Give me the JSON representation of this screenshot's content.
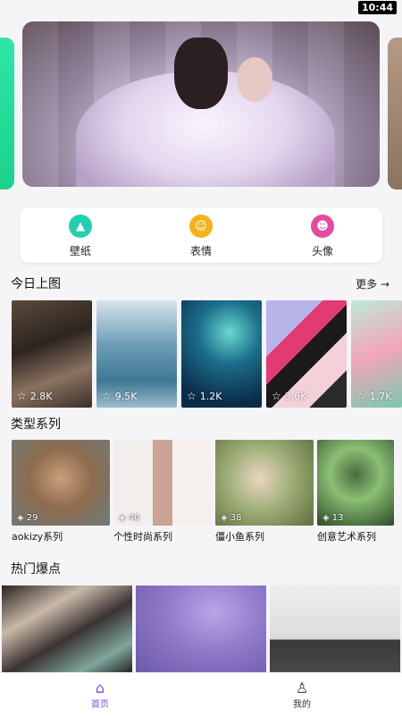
{
  "status": {
    "time": "10:44"
  },
  "categories": [
    {
      "label": "壁纸",
      "icon": "mountain-icon",
      "color": "#22d0b0"
    },
    {
      "label": "表情",
      "icon": "smile-icon",
      "color": "#f5b21a"
    },
    {
      "label": "头像",
      "icon": "avatar-icon",
      "color": "#e64aa0"
    }
  ],
  "today": {
    "title": "今日上图",
    "more": "更多 →",
    "items": [
      {
        "count": "2.8K"
      },
      {
        "count": "9.5K"
      },
      {
        "count": "1.2K"
      },
      {
        "count": "3.6K"
      },
      {
        "count": "1.7K"
      }
    ]
  },
  "series": {
    "title": "类型系列",
    "items": [
      {
        "name": "aokizy系列",
        "count": "29"
      },
      {
        "name": "个性时尚系列",
        "count": "40"
      },
      {
        "name": "僵小鱼系列",
        "count": "38"
      },
      {
        "name": "创意艺术系列",
        "count": "13"
      }
    ]
  },
  "hot": {
    "title": "热门爆点"
  },
  "tabbar": {
    "home": "首页",
    "mine": "我的"
  }
}
